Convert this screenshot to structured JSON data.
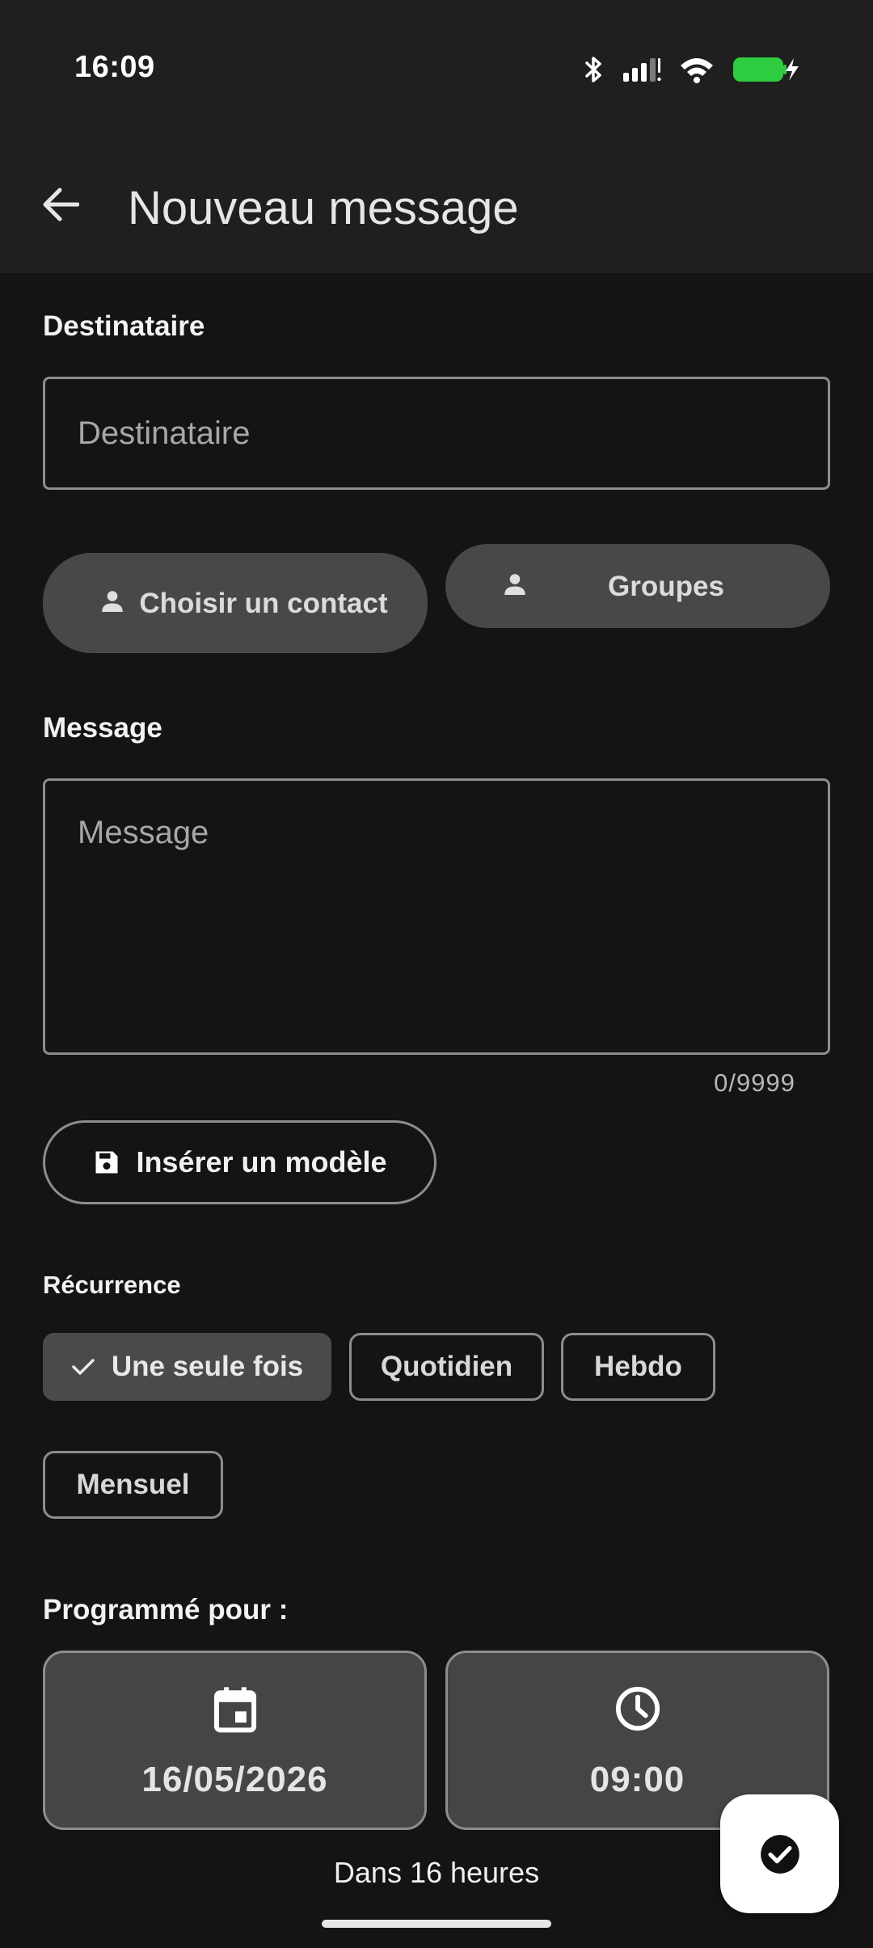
{
  "status_bar": {
    "time": "16:09"
  },
  "app_bar": {
    "title": "Nouveau message"
  },
  "recipient": {
    "label": "Destinataire",
    "value": "",
    "placeholder": "Destinataire"
  },
  "buttons": {
    "choose_contact": "Choisir un contact",
    "groups": "Groupes",
    "insert_template": "Insérer un modèle"
  },
  "message": {
    "label": "Message",
    "value": "",
    "placeholder": "Message",
    "counter": "0/9999"
  },
  "recurrence": {
    "label": "Récurrence",
    "selected": "Une seule fois",
    "options": [
      "Une seule fois",
      "Quotidien",
      "Hebdo",
      "Mensuel"
    ]
  },
  "schedule": {
    "label": "Programmé pour :",
    "date": "16/05/2026",
    "time": "09:00",
    "hint": "Dans 16 heures"
  },
  "colors": {
    "background": "#141414",
    "appbar": "#1f1f1f",
    "surface": "#484848",
    "outline": "#8d8d8d",
    "battery": "#2ecc40",
    "fab": "#ffffff"
  },
  "icons": {
    "back": "arrow-left-icon",
    "person": "person-icon",
    "save": "save-icon",
    "check": "check-icon",
    "calendar": "calendar-icon",
    "clock": "clock-icon",
    "fab": "check-circle-icon"
  }
}
